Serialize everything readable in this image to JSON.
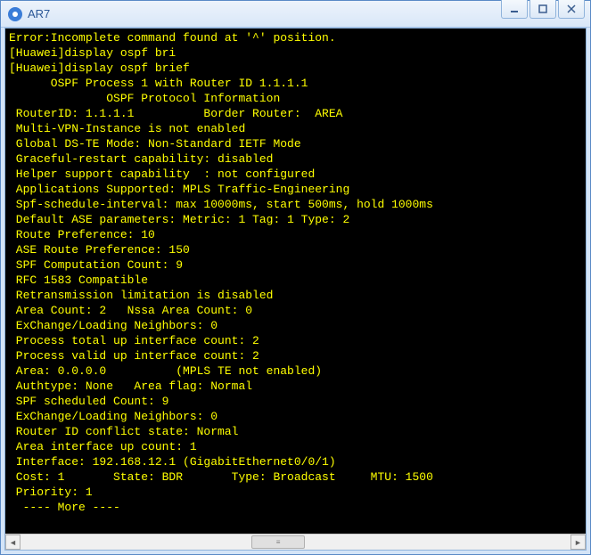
{
  "window": {
    "title": "AR7"
  },
  "terminal": {
    "lines": [
      "Error:Incomplete command found at '^' position.",
      "[Huawei]display ospf bri",
      "[Huawei]display ospf brief",
      "",
      "      OSPF Process 1 with Router ID 1.1.1.1",
      "              OSPF Protocol Information",
      "",
      " RouterID: 1.1.1.1          Border Router:  AREA",
      " Multi-VPN-Instance is not enabled",
      " Global DS-TE Mode: Non-Standard IETF Mode",
      " Graceful-restart capability: disabled",
      " Helper support capability  : not configured",
      " Applications Supported: MPLS Traffic-Engineering",
      " Spf-schedule-interval: max 10000ms, start 500ms, hold 1000ms",
      " Default ASE parameters: Metric: 1 Tag: 1 Type: 2",
      " Route Preference: 10",
      " ASE Route Preference: 150",
      " SPF Computation Count: 9",
      " RFC 1583 Compatible",
      " Retransmission limitation is disabled",
      " Area Count: 2   Nssa Area Count: 0",
      " ExChange/Loading Neighbors: 0",
      " Process total up interface count: 2",
      " Process valid up interface count: 2",
      "",
      " Area: 0.0.0.0          (MPLS TE not enabled)",
      " Authtype: None   Area flag: Normal",
      " SPF scheduled Count: 9",
      " ExChange/Loading Neighbors: 0",
      " Router ID conflict state: Normal",
      " Area interface up count: 1",
      "",
      " Interface: 192.168.12.1 (GigabitEthernet0/0/1)",
      " Cost: 1       State: BDR       Type: Broadcast     MTU: 1500",
      " Priority: 1",
      "  ---- More ----"
    ]
  }
}
